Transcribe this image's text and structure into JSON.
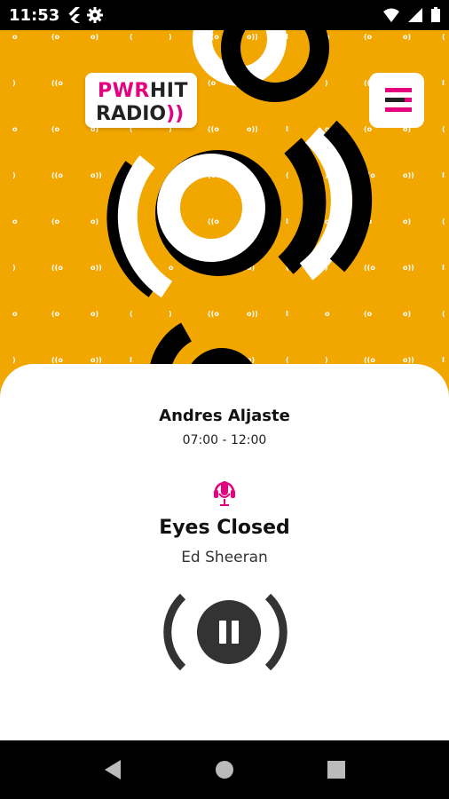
{
  "status_bar": {
    "time": "11:53"
  },
  "logo": {
    "line1_brand": "PWR",
    "line1_rest": "HIT",
    "line2_text": "RADIO",
    "line2_waves": "))"
  },
  "now_playing": {
    "host": "Andres Aljaste",
    "time_slot": "07:00 - 12:00",
    "song_title": "Eyes Closed",
    "artist": "Ed Sheeran"
  },
  "colors": {
    "brand_yellow": "#f2a600",
    "accent_pink": "#e5007d",
    "dark": "#333333"
  },
  "icons": {
    "menu": "hamburger-menu-icon",
    "live_host": "microphone-headset-icon",
    "playback": "pause-icon"
  }
}
